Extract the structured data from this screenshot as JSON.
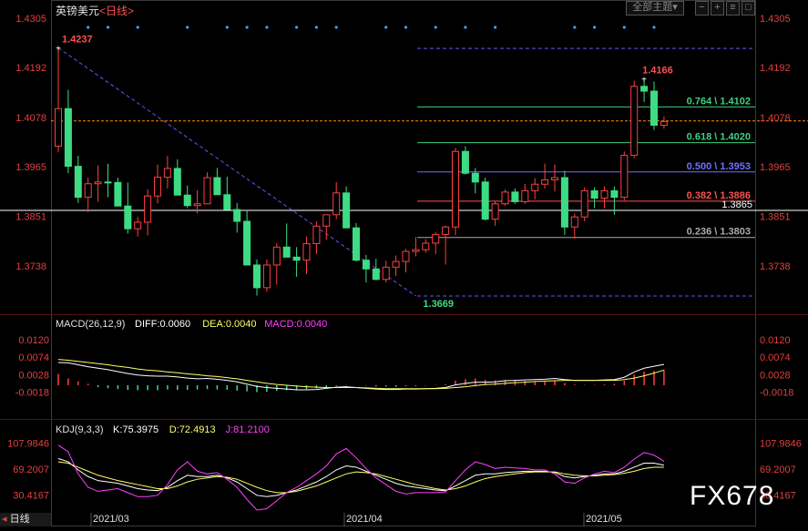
{
  "header": {
    "instrument": "英镑美元",
    "period": "<日线>",
    "theme_button": "全部主题",
    "theme_arrow": "▾"
  },
  "watermark": "FX678",
  "bottom_left_tag": "日线",
  "colors": {
    "up": "#ff4040",
    "down": "#3ddc84",
    "bg": "#000000",
    "axis_text": "#e04040",
    "fib_line": "#7070ff"
  },
  "chart_data": [
    {
      "type": "candlestick",
      "title": "英镑美元<日线>",
      "ylim": [
        1.3669,
        1.4305
      ],
      "y_ticks": [
        "1.4305",
        "1.4192",
        "1.4078",
        "1.3965",
        "1.3851",
        "1.3738"
      ],
      "x_ticks": [
        "2021/03",
        "2021/04",
        "2021/05"
      ],
      "candles": [
        [
          1.4012,
          1.4237,
          1.3998,
          1.4098
        ],
        [
          1.4098,
          1.4141,
          1.395,
          1.3966
        ],
        [
          1.3966,
          1.399,
          1.3882,
          1.3895
        ],
        [
          1.3895,
          1.394,
          1.3861,
          1.3926
        ],
        [
          1.3926,
          1.3968,
          1.3885,
          1.393
        ],
        [
          1.393,
          1.3972,
          1.3895,
          1.3929
        ],
        [
          1.3929,
          1.394,
          1.3877,
          1.3875
        ],
        [
          1.3875,
          1.3929,
          1.3812,
          1.3823
        ],
        [
          1.3823,
          1.385,
          1.3805,
          1.3838
        ],
        [
          1.3838,
          1.3913,
          1.3808,
          1.3898
        ],
        [
          1.3898,
          1.397,
          1.3881,
          1.3941
        ],
        [
          1.3941,
          1.399,
          1.3915,
          1.3961
        ],
        [
          1.3961,
          1.3982,
          1.3925,
          1.39
        ],
        [
          1.39,
          1.3922,
          1.387,
          1.3876
        ],
        [
          1.3876,
          1.3911,
          1.3858,
          1.388
        ],
        [
          1.388,
          1.3952,
          1.3879,
          1.394
        ],
        [
          1.394,
          1.3962,
          1.39,
          1.3901
        ],
        [
          1.3901,
          1.3942,
          1.3868,
          1.3867
        ],
        [
          1.3867,
          1.3882,
          1.3814,
          1.384
        ],
        [
          1.384,
          1.3865,
          1.3755,
          1.374
        ],
        [
          1.374,
          1.3753,
          1.367,
          1.3688
        ],
        [
          1.3688,
          1.3753,
          1.3679,
          1.374
        ],
        [
          1.374,
          1.379,
          1.3695,
          1.3781
        ],
        [
          1.3781,
          1.3835,
          1.376,
          1.3758
        ],
        [
          1.3758,
          1.3781,
          1.3713,
          1.3751
        ],
        [
          1.3751,
          1.3805,
          1.3719,
          1.3789
        ],
        [
          1.3789,
          1.384,
          1.3765,
          1.3829
        ],
        [
          1.3829,
          1.385,
          1.3798,
          1.3855
        ],
        [
          1.3855,
          1.393,
          1.3845,
          1.3905
        ],
        [
          1.3905,
          1.392,
          1.3835,
          1.3825
        ],
        [
          1.3825,
          1.3836,
          1.3748,
          1.3751
        ],
        [
          1.3751,
          1.3763,
          1.37,
          1.3731
        ],
        [
          1.3731,
          1.3754,
          1.3705,
          1.3707
        ],
        [
          1.3707,
          1.375,
          1.37,
          1.3735
        ],
        [
          1.3735,
          1.3762,
          1.3715,
          1.3748
        ],
        [
          1.3748,
          1.3777,
          1.3723,
          1.3771
        ],
        [
          1.3771,
          1.3804,
          1.376,
          1.3775
        ],
        [
          1.3775,
          1.3799,
          1.3768,
          1.379
        ],
        [
          1.379,
          1.3815,
          1.3765,
          1.381
        ],
        [
          1.381,
          1.383,
          1.3741,
          1.3827
        ],
        [
          1.3827,
          1.4008,
          1.3808,
          1.4
        ],
        [
          1.4,
          1.4012,
          1.3947,
          1.395
        ],
        [
          1.395,
          1.3962,
          1.3904,
          1.393
        ],
        [
          1.393,
          1.394,
          1.3842,
          1.3845
        ],
        [
          1.3845,
          1.3885,
          1.383,
          1.388
        ],
        [
          1.388,
          1.3913,
          1.3876,
          1.3907
        ],
        [
          1.3907,
          1.3915,
          1.388,
          1.3885
        ],
        [
          1.3885,
          1.3926,
          1.388,
          1.391
        ],
        [
          1.391,
          1.3939,
          1.389,
          1.3925
        ],
        [
          1.3925,
          1.3972,
          1.3915,
          1.3935
        ],
        [
          1.3935,
          1.397,
          1.3908,
          1.394
        ],
        [
          1.394,
          1.3956,
          1.3809,
          1.3827
        ],
        [
          1.3827,
          1.3858,
          1.38,
          1.385
        ],
        [
          1.385,
          1.3918,
          1.384,
          1.391
        ],
        [
          1.391,
          1.3918,
          1.387,
          1.3893
        ],
        [
          1.3893,
          1.392,
          1.387,
          1.391
        ],
        [
          1.391,
          1.392,
          1.3855,
          1.3895
        ],
        [
          1.3895,
          1.4,
          1.3888,
          1.3991
        ],
        [
          1.3991,
          1.4162,
          1.3985,
          1.4149
        ],
        [
          1.4149,
          1.4166,
          1.4113,
          1.4138
        ],
        [
          1.4138,
          1.416,
          1.4049,
          1.406
        ],
        [
          1.406,
          1.408,
          1.4052,
          1.4068
        ]
      ],
      "annotations": [
        {
          "price": 1.4237,
          "text": "1.4237"
        },
        {
          "price": 1.4166,
          "text": "1.4166"
        },
        {
          "price": 1.3669,
          "text": "1.3669"
        }
      ],
      "fib_levels": [
        {
          "label": "0.764 \\ 1.4102",
          "price": 1.4102,
          "color": "#3fcf7f"
        },
        {
          "label": "0.618 \\ 1.4020",
          "price": 1.402,
          "color": "#3fcf7f"
        },
        {
          "label": "0.500 \\ 1.3953",
          "price": 1.3953,
          "color": "#7070ff"
        },
        {
          "label": "0.382 \\ 1.3886",
          "price": 1.3886,
          "color": "#ff5050"
        },
        {
          "label": "0.236 \\ 1.3803",
          "price": 1.3803,
          "color": "#aaaaaa"
        }
      ],
      "fib_bounds": [
        1.4236,
        1.3669
      ],
      "current_price_line": 1.407,
      "horizontal_line": {
        "price": 1.3865,
        "label": "1.3865"
      }
    },
    {
      "type": "line",
      "title": "MACD(26,12,9)",
      "readouts": [
        {
          "name": "DIFF",
          "text": "DIFF:0.0060",
          "color": "#ffffff"
        },
        {
          "name": "DEA",
          "text": "DEA:0.0040",
          "color": "#ffff66"
        },
        {
          "name": "MACD",
          "text": "MACD:0.0040",
          "color": "#ff40ff"
        }
      ],
      "y_ticks": [
        "0.0120",
        "0.0074",
        "0.0028",
        "-0.0018"
      ],
      "ylim": [
        -0.0036,
        0.0132
      ],
      "series": [
        {
          "name": "DIFF",
          "values": [
            0.006,
            0.0059,
            0.0054,
            0.0049,
            0.0045,
            0.0041,
            0.0036,
            0.0031,
            0.0027,
            0.0025,
            0.0024,
            0.0024,
            0.0022,
            0.0019,
            0.0017,
            0.0018,
            0.0016,
            0.0013,
            0.0009,
            0.0003,
            -0.0003,
            -0.0006,
            -0.0008,
            -0.001,
            -0.0012,
            -0.0012,
            -0.0011,
            -0.0008,
            -0.0005,
            -0.0004,
            -0.0006,
            -0.0008,
            -0.001,
            -0.0011,
            -0.0011,
            -0.001,
            -0.001,
            -0.0009,
            -0.0008,
            -0.0006,
            0.0001,
            0.0005,
            0.0008,
            0.0008,
            0.0009,
            0.0012,
            0.0013,
            0.0014,
            0.0015,
            0.0016,
            0.0018,
            0.0015,
            0.0013,
            0.0013,
            0.0013,
            0.0014,
            0.0015,
            0.0021,
            0.0035,
            0.0045,
            0.005,
            0.0055
          ]
        },
        {
          "name": "DEA",
          "values": [
            0.0068,
            0.0066,
            0.0063,
            0.006,
            0.0057,
            0.0054,
            0.005,
            0.0047,
            0.0043,
            0.004,
            0.0038,
            0.0035,
            0.0033,
            0.003,
            0.0028,
            0.0025,
            0.0023,
            0.002,
            0.0017,
            0.0013,
            0.0009,
            0.0005,
            0.0002,
            0.0,
            -0.0002,
            -0.0004,
            -0.0005,
            -0.0006,
            -0.0006,
            -0.0006,
            -0.0006,
            -0.0007,
            -0.0008,
            -0.0009,
            -0.0009,
            -0.0009,
            -0.0009,
            -0.0009,
            -0.0009,
            -0.0008,
            -0.0006,
            -0.0004,
            -0.0001,
            0.0002,
            0.0003,
            0.0005,
            0.0007,
            0.0008,
            0.001,
            0.0011,
            0.0012,
            0.0013,
            0.0013,
            0.0013,
            0.0013,
            0.0013,
            0.0013,
            0.0015,
            0.0019,
            0.0025,
            0.0032,
            0.004
          ]
        },
        {
          "name": "MACD",
          "type": "histogram",
          "values": [
            0.003,
            0.0018,
            0.001,
            0.0004,
            -0.0005,
            -0.0008,
            -0.001,
            -0.0012,
            -0.0013,
            -0.0013,
            -0.0013,
            -0.0011,
            -0.0012,
            -0.0012,
            -0.0011,
            -0.001,
            -0.0011,
            -0.0012,
            -0.0014,
            -0.0016,
            -0.0018,
            -0.0017,
            -0.0015,
            -0.0013,
            -0.0011,
            -0.001,
            -0.0008,
            -0.0005,
            -0.0002,
            0.0001,
            0.0,
            -0.0001,
            -0.0003,
            -0.0003,
            -0.0004,
            -0.0002,
            -0.0002,
            -0.0001,
            0.0001,
            0.0003,
            0.0012,
            0.0016,
            0.0018,
            0.0014,
            0.0013,
            0.0014,
            0.0012,
            0.0012,
            0.0011,
            0.0011,
            0.0012,
            0.0006,
            0.0002,
            0.0001,
            0.0001,
            0.0002,
            0.0004,
            0.0012,
            0.0028,
            0.0036,
            0.0038,
            0.004
          ]
        }
      ]
    },
    {
      "type": "line",
      "title": "KDJ(9,3,3)",
      "readouts": [
        {
          "name": "K",
          "text": "K:75.3975",
          "color": "#ffffff"
        },
        {
          "name": "D",
          "text": "D:72.4913",
          "color": "#ffff66"
        },
        {
          "name": "J",
          "text": "J:81.2100",
          "color": "#ff40ff"
        }
      ],
      "y_ticks": [
        "107.9846",
        "69.2007",
        "30.4167"
      ],
      "ylim": [
        8,
        125
      ],
      "series": [
        {
          "name": "K",
          "values": [
            85,
            80,
            68,
            58,
            52,
            50,
            48,
            44,
            40,
            38,
            37,
            42,
            52,
            60,
            58,
            58,
            60,
            56,
            50,
            40,
            30,
            28,
            30,
            34,
            38,
            44,
            50,
            58,
            68,
            74,
            72,
            66,
            60,
            54,
            48,
            44,
            42,
            40,
            38,
            37,
            44,
            52,
            60,
            62,
            62,
            64,
            65,
            66,
            66,
            66,
            64,
            58,
            56,
            58,
            60,
            62,
            62,
            66,
            72,
            78,
            78,
            75
          ]
        },
        {
          "name": "D",
          "values": [
            80,
            78,
            72,
            66,
            60,
            56,
            52,
            49,
            46,
            43,
            40,
            40,
            44,
            50,
            54,
            56,
            58,
            57,
            54,
            48,
            42,
            37,
            34,
            34,
            36,
            40,
            44,
            50,
            56,
            62,
            65,
            64,
            62,
            58,
            54,
            50,
            46,
            43,
            40,
            38,
            40,
            44,
            50,
            55,
            58,
            60,
            62,
            64,
            65,
            65,
            65,
            62,
            60,
            59,
            59,
            60,
            61,
            63,
            66,
            70,
            72,
            72
          ]
        },
        {
          "name": "J",
          "values": [
            105,
            95,
            62,
            42,
            36,
            38,
            40,
            34,
            28,
            28,
            30,
            46,
            68,
            80,
            66,
            62,
            64,
            54,
            42,
            24,
            8,
            10,
            22,
            34,
            42,
            52,
            62,
            74,
            92,
            100,
            86,
            70,
            56,
            46,
            36,
            32,
            34,
            34,
            34,
            35,
            52,
            68,
            80,
            76,
            70,
            72,
            71,
            70,
            68,
            68,
            62,
            50,
            48,
            56,
            62,
            66,
            64,
            72,
            84,
            94,
            90,
            81
          ]
        }
      ]
    }
  ]
}
